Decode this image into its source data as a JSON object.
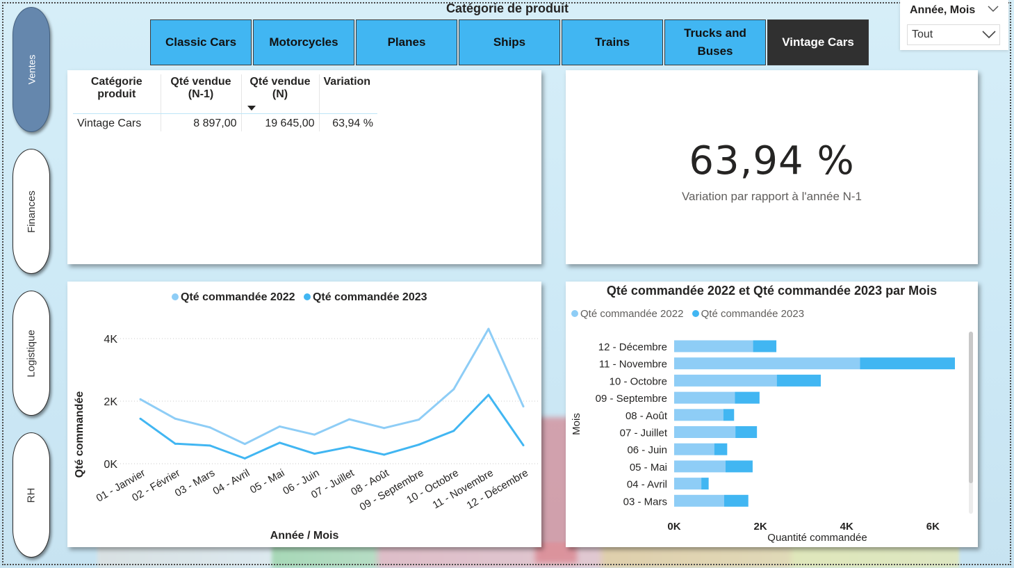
{
  "nav": [
    {
      "label": "Ventes",
      "active": true
    },
    {
      "label": "Finances",
      "active": false
    },
    {
      "label": "Logistique",
      "active": false
    },
    {
      "label": "RH",
      "active": false
    }
  ],
  "category_slicer": {
    "title": "Catégorie de produit",
    "tiles": [
      {
        "label": "Classic Cars",
        "selected": false
      },
      {
        "label": "Motorcycles",
        "selected": false
      },
      {
        "label": "Planes",
        "selected": false
      },
      {
        "label": "Ships",
        "selected": false
      },
      {
        "label": "Trains",
        "selected": false
      },
      {
        "label": "Trucks and Buses",
        "selected": false
      },
      {
        "label": "Vintage Cars",
        "selected": true
      }
    ]
  },
  "date_slicer": {
    "title": "Année, Mois",
    "value": "Tout"
  },
  "table": {
    "headers": [
      "Catégorie produit",
      "Qté vendue (N-1)",
      "Qté vendue (N)",
      "Variation"
    ],
    "rows": [
      [
        "Vintage Cars",
        "8 897,00",
        "19 645,00",
        "63,94 %"
      ]
    ]
  },
  "kpi": {
    "value": "63,94 %",
    "label": "Variation par rapport à l'année N-1"
  },
  "colors": {
    "s2022": "#8ecdf6",
    "s2023": "#41b6f2",
    "tile": "#41b6f2",
    "tile_selected": "#303030",
    "nav_active": "#6587ad"
  },
  "chart_data": [
    {
      "type": "line",
      "title": "",
      "xlabel": "Année / Mois",
      "ylabel": "Qté commandée",
      "ylim": [
        0,
        4600
      ],
      "yticks": [
        "0K",
        "2K",
        "4K"
      ],
      "grid": true,
      "legend_position": "top",
      "categories": [
        "01 - Janvier",
        "02 - Février",
        "03 - Mars",
        "04 - Avril",
        "05 - Mai",
        "06 - Juin",
        "07 - Juillet",
        "08 - Août",
        "09 - Septembre",
        "10 - Octobre",
        "11 - Novembre",
        "12 - Décembre"
      ],
      "series": [
        {
          "name": "Qté commandée 2022",
          "values": [
            2060,
            1440,
            1160,
            630,
            1190,
            930,
            1420,
            1140,
            1410,
            2380,
            4310,
            1830
          ]
        },
        {
          "name": "Qté commandée 2023",
          "values": [
            1440,
            640,
            580,
            170,
            670,
            320,
            540,
            290,
            610,
            1050,
            2200,
            590
          ]
        }
      ]
    },
    {
      "type": "bar",
      "orientation": "horizontal",
      "stacked": true,
      "title": "Qté commandée 2022 et Qté commandée 2023 par Mois",
      "xlabel": "Quantité commandée",
      "ylabel": "Mois",
      "xlim": [
        0,
        6800
      ],
      "xticks": [
        "0K",
        "2K",
        "4K",
        "6K"
      ],
      "legend_position": "top-left",
      "categories": [
        "12 - Décembre",
        "11 - Novembre",
        "10 - Octobre",
        "09 - Septembre",
        "08 - Août",
        "07 - Juillet",
        "06 - Juin",
        "05 - Mai",
        "04 - Avril",
        "03 - Mars"
      ],
      "series": [
        {
          "name": "Qté commandée 2022",
          "values": [
            1830,
            4310,
            2380,
            1410,
            1140,
            1420,
            930,
            1190,
            630,
            1160
          ]
        },
        {
          "name": "Qté commandée 2023",
          "values": [
            540,
            2200,
            1020,
            570,
            250,
            500,
            300,
            630,
            170,
            560
          ]
        }
      ]
    }
  ]
}
